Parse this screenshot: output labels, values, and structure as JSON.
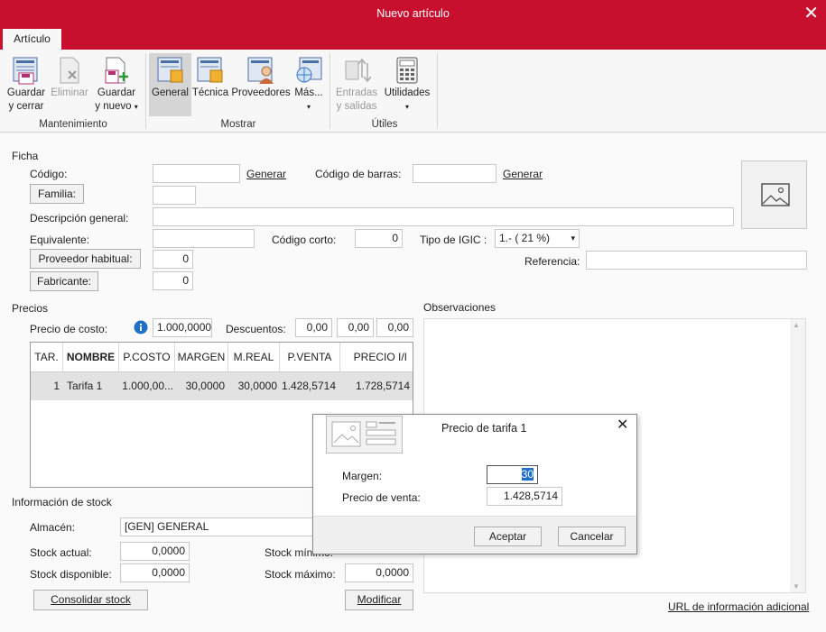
{
  "window": {
    "title": "Nuevo artículo",
    "close_glyph": "✕"
  },
  "tabs": [
    {
      "label": "Artículo"
    }
  ],
  "ribbon": {
    "buttons": {
      "guardar_cerrar": {
        "line1": "Guardar",
        "line2": "y cerrar",
        "icon": "save-close-icon"
      },
      "eliminar": {
        "line1": "Eliminar",
        "icon": "delete-icon"
      },
      "guardar_nuevo": {
        "line1": "Guardar",
        "line2": "y nuevo",
        "icon": "save-new-icon"
      },
      "general": {
        "line1": "General",
        "icon": "general-icon"
      },
      "tecnica": {
        "line1": "Técnica",
        "icon": "tecnica-icon"
      },
      "proveedores": {
        "line1": "Proveedores",
        "icon": "proveedores-icon"
      },
      "mas": {
        "line1": "Más...",
        "icon": "mas-icon"
      },
      "entradas": {
        "line1": "Entradas",
        "line2": "y salidas",
        "icon": "entradas-salidas-icon"
      },
      "utilidades": {
        "line1": "Utilidades",
        "icon": "calculator-icon"
      }
    },
    "groups": {
      "mantenimiento": "Mantenimiento",
      "mostrar": "Mostrar",
      "utiles": "Útiles"
    },
    "caret": "▾"
  },
  "ficha": {
    "section": "Ficha",
    "codigo_label": "Código:",
    "codigo_value": "",
    "generar": "Generar",
    "codigo_barras_label": "Código de barras:",
    "codigo_barras_value": "",
    "familia_button": "Familia:",
    "familia_value": "",
    "descripcion_label": "Descripción general:",
    "descripcion_value": "",
    "equivalente_label": "Equivalente:",
    "equivalente_value": "",
    "codigo_corto_label": "Código corto:",
    "codigo_corto_value": "0",
    "tipo_igic_label": "Tipo de IGIC :",
    "tipo_igic_value": "1.- ( 21 %)",
    "proveedor_button": "Proveedor habitual:",
    "proveedor_value": "0",
    "referencia_label": "Referencia:",
    "referencia_value": "",
    "fabricante_button": "Fabricante:",
    "fabricante_value": "0"
  },
  "precios": {
    "section": "Precios",
    "precio_costo_label": "Precio de costo:",
    "precio_costo_value": "1.000,0000",
    "descuentos_label": "Descuentos:",
    "descuentos": [
      "0,00",
      "0,00",
      "0,00"
    ],
    "columns": [
      "TAR.",
      "NOMBRE",
      "P.COSTO",
      "MARGEN",
      "M.REAL",
      "P.VENTA",
      "PRECIO I/I"
    ],
    "rows": [
      {
        "tar": "1",
        "nombre": "Tarifa 1",
        "p_costo": "1.000,00...",
        "margen": "30,0000",
        "m_real": "30,0000",
        "p_venta": "1.428,5714",
        "precio_ii": "1.728,5714"
      }
    ]
  },
  "observaciones": {
    "label": "Observaciones",
    "up": "▲",
    "down": "▼"
  },
  "stock": {
    "section": "Información de stock",
    "almacen_label": "Almacén:",
    "almacen_value": "[GEN] GENERAL",
    "stock_actual_label": "Stock actual:",
    "stock_actual_value": "0,0000",
    "stock_minimo_label": "Stock mínimo:",
    "stock_disponible_label": "Stock disponible:",
    "stock_disponible_value": "0,0000",
    "stock_maximo_label": "Stock máximo:",
    "stock_maximo_value": "0,0000",
    "consolidar_button": "Consolidar stock",
    "modificar_button": "Modificar"
  },
  "url_info": "URL de información adicional",
  "dialog": {
    "title": "Precio de tarifa 1",
    "close_glyph": "✕",
    "margen_label": "Margen:",
    "margen_value": "30",
    "precio_venta_label": "Precio de venta:",
    "precio_venta_value": "1.428,5714",
    "aceptar": "Aceptar",
    "cancelar": "Cancelar"
  },
  "colors": {
    "brand": "#c8102e",
    "info": "#1e6fc8"
  }
}
